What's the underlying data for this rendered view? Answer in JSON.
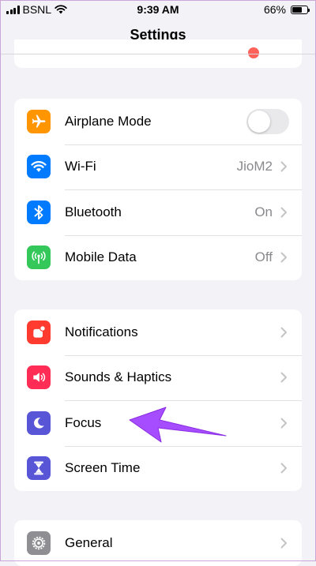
{
  "status_bar": {
    "carrier": "BSNL",
    "time": "9:39 AM",
    "battery_percent": "66%",
    "battery_level": 0.66
  },
  "nav": {
    "title": "Settings"
  },
  "groups": [
    {
      "rows": [
        {
          "label": "Airplane Mode",
          "icon": "airplane-icon",
          "icon_color": "#ff9500",
          "control": "toggle",
          "toggle_on": false
        },
        {
          "label": "Wi-Fi",
          "value": "JioM2",
          "icon": "wifi-icon",
          "icon_color": "#007aff",
          "control": "chevron"
        },
        {
          "label": "Bluetooth",
          "value": "On",
          "icon": "bluetooth-icon",
          "icon_color": "#007aff",
          "control": "chevron"
        },
        {
          "label": "Mobile Data",
          "value": "Off",
          "icon": "antenna-icon",
          "icon_color": "#34c759",
          "control": "chevron"
        }
      ]
    },
    {
      "rows": [
        {
          "label": "Notifications",
          "icon": "notifications-icon",
          "icon_color": "#ff3b30",
          "control": "chevron"
        },
        {
          "label": "Sounds & Haptics",
          "icon": "speaker-icon",
          "icon_color": "#ff2d55",
          "control": "chevron"
        },
        {
          "label": "Focus",
          "icon": "moon-icon",
          "icon_color": "#5856d6",
          "control": "chevron"
        },
        {
          "label": "Screen Time",
          "icon": "hourglass-icon",
          "icon_color": "#5856d6",
          "control": "chevron"
        }
      ]
    },
    {
      "rows": [
        {
          "label": "General",
          "icon": "gear-icon",
          "icon_color": "#8e8e93",
          "control": "chevron"
        }
      ]
    }
  ],
  "annotation": {
    "arrow_color": "#a64dff",
    "points_to": "Focus"
  }
}
